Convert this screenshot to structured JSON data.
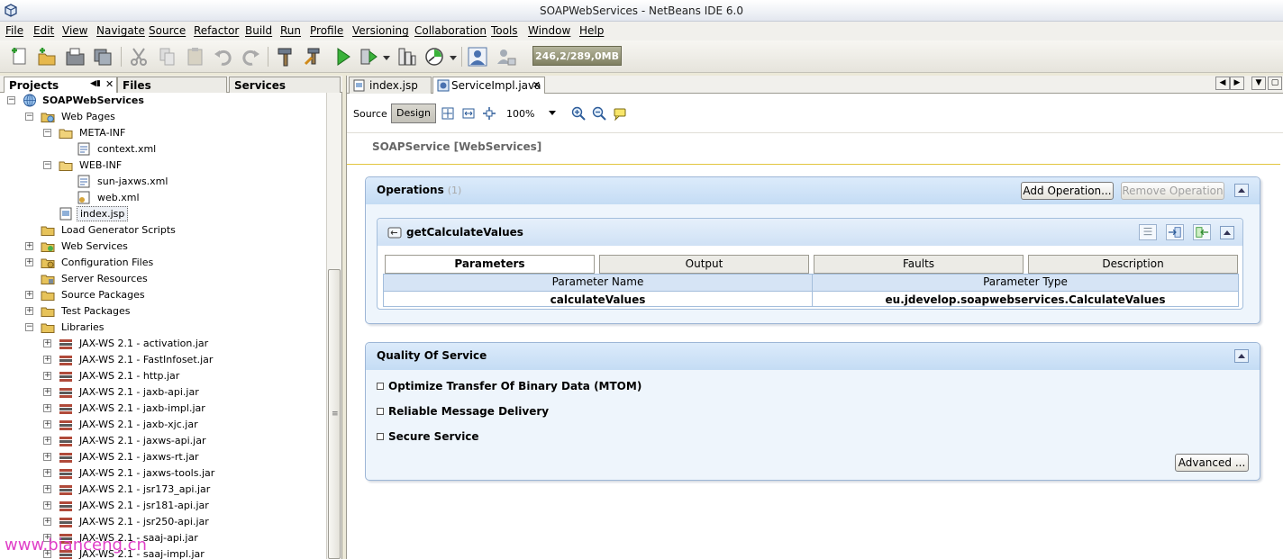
{
  "window": {
    "title": "SOAPWebServices - NetBeans IDE 6.0"
  },
  "menu": [
    "File",
    "Edit",
    "View",
    "Navigate",
    "Source",
    "Refactor",
    "Build",
    "Run",
    "Profile",
    "Versioning",
    "Collaboration",
    "Tools",
    "Window",
    "Help"
  ],
  "toolbar": {
    "memory": "246,2/289,0MB"
  },
  "left_tabs": {
    "projects": "Projects",
    "files": "Files",
    "services": "Services"
  },
  "tree": [
    "SOAPWebServices",
    "Web Pages",
    "META-INF",
    "context.xml",
    "WEB-INF",
    "sun-jaxws.xml",
    "web.xml",
    "index.jsp",
    "Load Generator Scripts",
    "Web Services",
    "Configuration Files",
    "Server Resources",
    "Source Packages",
    "Test Packages",
    "Libraries",
    "JAX-WS 2.1 - activation.jar",
    "JAX-WS 2.1 - FastInfoset.jar",
    "JAX-WS 2.1 - http.jar",
    "JAX-WS 2.1 - jaxb-api.jar",
    "JAX-WS 2.1 - jaxb-impl.jar",
    "JAX-WS 2.1 - jaxb-xjc.jar",
    "JAX-WS 2.1 - jaxws-api.jar",
    "JAX-WS 2.1 - jaxws-rt.jar",
    "JAX-WS 2.1 - jaxws-tools.jar",
    "JAX-WS 2.1 - jsr173_api.jar",
    "JAX-WS 2.1 - jsr181-api.jar",
    "JAX-WS 2.1 - jsr250-api.jar",
    "JAX-WS 2.1 - saaj-api.jar",
    "JAX-WS 2.1 - saaj-impl.jar"
  ],
  "editor_tabs": {
    "tab1": "index.jsp",
    "tab2": "ServiceImpl.java"
  },
  "design_bar": {
    "source": "Source",
    "design": "Design",
    "zoom": "100%"
  },
  "service_title": "SOAPService [WebServices]",
  "operations": {
    "title": "Operations",
    "count": "(1)",
    "add": "Add Operation...",
    "remove": "Remove Operation",
    "op_name": "getCalculateValues",
    "tabs": [
      "Parameters",
      "Output",
      "Faults",
      "Description"
    ],
    "headers": [
      "Parameter Name",
      "Parameter Type"
    ],
    "rows": [
      [
        "calculateValues",
        "eu.jdevelop.soapwebservices.CalculateValues"
      ]
    ]
  },
  "qos": {
    "title": "Quality Of Service",
    "items": [
      "Optimize Transfer Of Binary Data (MTOM)",
      "Reliable Message Delivery",
      "Secure Service"
    ],
    "advanced": "Advanced ..."
  },
  "watermark": "www.bianceng.cn"
}
